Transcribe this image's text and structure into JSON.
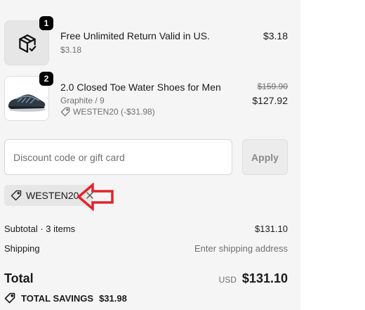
{
  "items": [
    {
      "qty": "1",
      "name": "Free Unlimited Return Valid in US.",
      "sub": "$3.18",
      "price": "$3.18",
      "icon": "package-check-icon"
    },
    {
      "qty": "2",
      "name": "2.0 Closed Toe Water Shoes for Men",
      "variant": "Graphite / 9",
      "discount": "WESTEN20 (-$31.98)",
      "original_price": "$159.90",
      "price": "$127.92",
      "icon": "shoe-image"
    }
  ],
  "discount": {
    "placeholder": "Discount code or gift card",
    "apply_label": "Apply",
    "applied_code": "WESTEN20"
  },
  "summary": {
    "subtotal_label": "Subtotal · 3 items",
    "subtotal_value": "$131.10",
    "shipping_label": "Shipping",
    "shipping_value": "Enter shipping address",
    "total_label": "Total",
    "currency": "USD",
    "total_value": "$131.10",
    "savings_label": "TOTAL SAVINGS",
    "savings_value": "$31.98"
  },
  "colors": {
    "panel_bg": "#f5f5f5",
    "annotation_arrow": "#e0242a"
  }
}
